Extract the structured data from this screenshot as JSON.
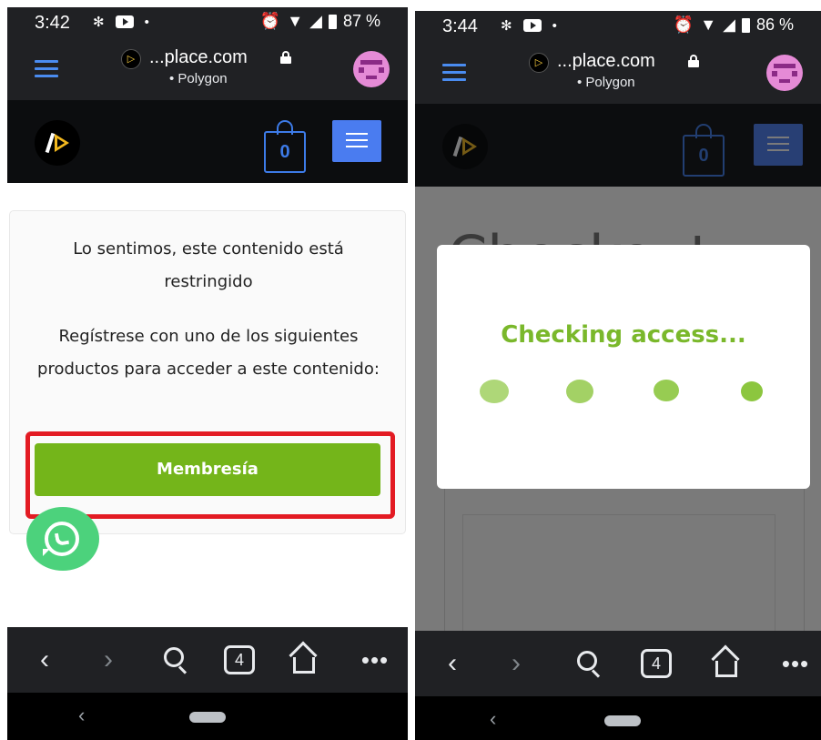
{
  "left": {
    "status": {
      "time": "3:42",
      "battery": "87 %"
    },
    "browser": {
      "domain": "...place.com",
      "network": "• Polygon"
    },
    "site": {
      "cart_count": "0"
    },
    "restricted": {
      "message": "Lo sentimos, este contenido está restringido",
      "instruction": "Regístrese con uno de los siguientes productos para acceder a este contenido:",
      "product_button": "Membresía"
    },
    "nav": {
      "back": "‹",
      "forward": "›",
      "tabs": "4",
      "more": "•••"
    },
    "sysbar": {
      "back": "‹"
    }
  },
  "right": {
    "status": {
      "time": "3:44",
      "battery": "86 %"
    },
    "browser": {
      "domain": "...place.com",
      "network": "• Polygon"
    },
    "site": {
      "cart_count": "0"
    },
    "modal": {
      "title": "Checking access..."
    },
    "background_title": "Checkout",
    "nav": {
      "back": "‹",
      "forward": "›",
      "tabs": "4",
      "more": "•••"
    },
    "sysbar": {
      "back": "‹"
    }
  },
  "colors": {
    "accent_green": "#74b51a",
    "highlight_red": "#e31b23",
    "site_blue": "#4a7cf0",
    "whatsapp_green": "#4cd27c"
  },
  "icons": [
    "menu-icon",
    "lock-icon",
    "cart-icon",
    "hamburger-icon",
    "whatsapp-icon",
    "back-icon",
    "forward-icon",
    "search-icon",
    "tabs-icon",
    "home-icon",
    "more-icon"
  ]
}
